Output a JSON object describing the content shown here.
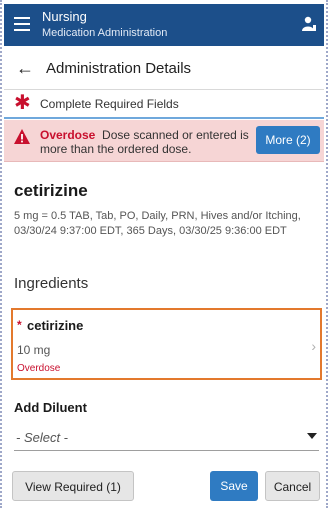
{
  "app": {
    "title": "Nursing",
    "subtitle": "Medication Administration"
  },
  "toolbar": {
    "title": "Administration Details"
  },
  "required_banner": {
    "text": "Complete Required Fields"
  },
  "alert": {
    "label": "Overdose",
    "message": "Dose scanned or entered is more than the ordered dose.",
    "more_button": "More (2)"
  },
  "medication": {
    "name": "cetirizine",
    "details": "5 mg = 0.5 TAB, Tab, PO, Daily, PRN, Hives and/or Itching, 03/30/24 9:37:00 EDT, 365 Days, 03/30/25 9:36:00 EDT"
  },
  "ingredients": {
    "label": "Ingredients",
    "items": [
      {
        "name": "cetirizine",
        "dose": "10 mg",
        "warning": "Overdose"
      }
    ]
  },
  "diluent": {
    "label": "Add Diluent",
    "select_value": "- Select -"
  },
  "footer": {
    "view_required": "View Required (1)",
    "save": "Save",
    "cancel": "Cancel"
  },
  "colors": {
    "header": "#1c4f8a",
    "alert_bg": "#f6d5d5",
    "alert_text": "#c8102e",
    "primary_button": "#2f7bc2",
    "highlight_border": "#e3792d"
  }
}
